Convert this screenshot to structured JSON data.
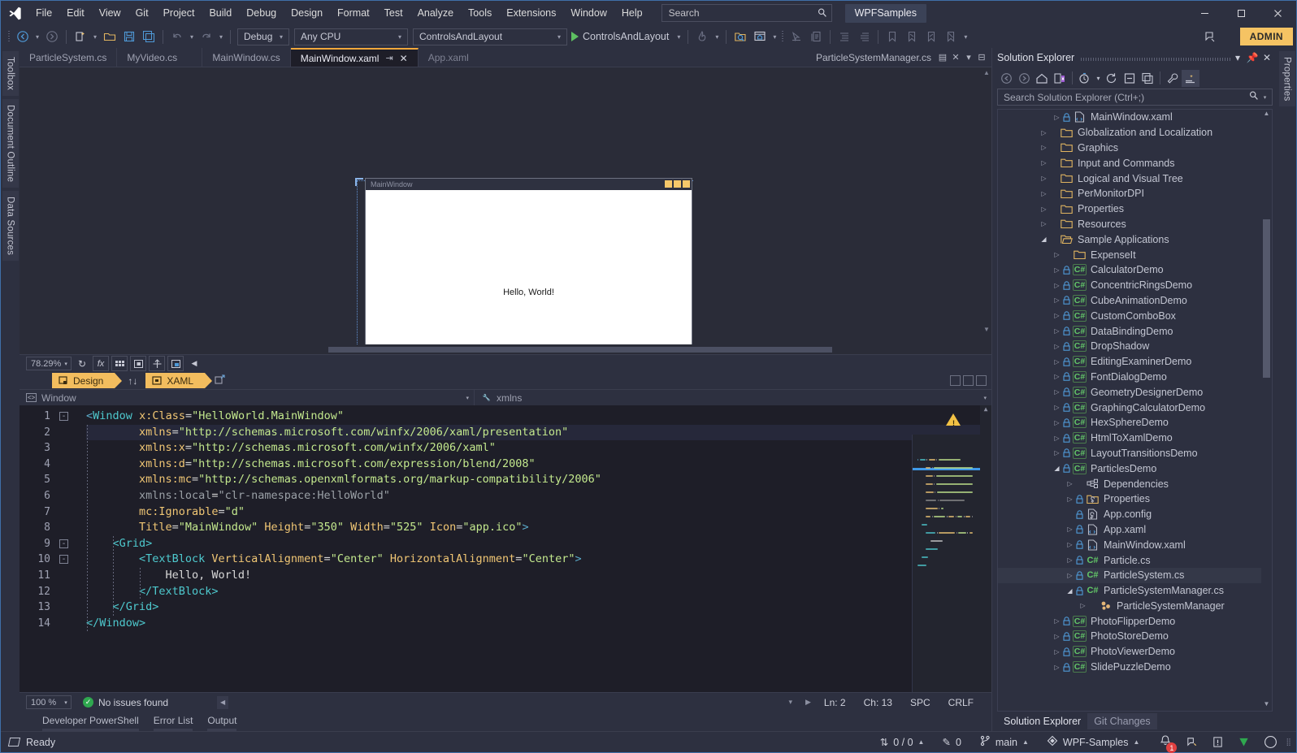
{
  "titlebar": {
    "logo_icon": "visual-studio-logo",
    "menus": [
      "File",
      "Edit",
      "View",
      "Git",
      "Project",
      "Build",
      "Debug",
      "Design",
      "Format",
      "Test",
      "Analyze",
      "Tools",
      "Extensions",
      "Window",
      "Help"
    ],
    "search_placeholder": "Search",
    "search_icon": "magnifier-icon",
    "project_chip": "WPFSamples",
    "window_buttons": {
      "minimize": "─",
      "maximize": "☐",
      "close": "✕"
    }
  },
  "toolbar": {
    "nav_back_icon": "navigate-back-icon",
    "nav_forward_icon": "navigate-forward-icon",
    "new_item_icon": "new-item-icon",
    "open_file_icon": "open-file-icon",
    "save_icon": "save-icon",
    "save_all_icon": "save-all-icon",
    "undo_icon": "undo-icon",
    "redo_icon": "redo-icon",
    "config_value": "Debug",
    "platform_value": "Any CPU",
    "startup_value": "ControlsAndLayout",
    "run_label": "ControlsAndLayout",
    "run_icon": "play-icon",
    "hot_reload_icon": "hot-reload-icon",
    "find_in_files_icon": "find-in-files-icon",
    "solution_explorer_icon": "window-home-icon",
    "pointer_icon": "pointer-icon",
    "comment_icon": "comment-icon",
    "indent_icon": "indent-icon",
    "outdent_icon": "outdent-icon",
    "bookmark_icons": [
      "bookmark-icon",
      "bookmark-next-icon",
      "bookmark-prev-icon",
      "bookmark-clear-icon"
    ],
    "feedback_icon": "feedback-icon",
    "admin_label": "ADMIN"
  },
  "left_rail": [
    "Toolbox",
    "Document Outline",
    "Data Sources"
  ],
  "right_rail": [
    "Properties"
  ],
  "tabs": {
    "items": [
      {
        "label": "ParticleSystem.cs",
        "selected": false
      },
      {
        "label": "MyVideo.cs",
        "selected": false
      },
      {
        "label": "MainWindow.cs",
        "selected": false
      },
      {
        "label": "MainWindow.xaml",
        "selected": true
      },
      {
        "label": "App.xaml",
        "selected": false
      }
    ],
    "pin_icon": "pin-icon",
    "close_icon": "close-icon",
    "right_doc": "ParticleSystemManager.cs",
    "right_close_icon": "close-icon",
    "right_chevron_icon": "chevron-down-icon",
    "right_list_icon": "document-list-icon"
  },
  "designer": {
    "window_title": "MainWindow",
    "content_text": "Hello, World!",
    "caption_buttons": 3
  },
  "designer_toolbar": {
    "zoom_value": "78.29%",
    "refresh_icon": "refresh-icon",
    "effects_icon": "fx-icon",
    "grid_icon": "grid-icon",
    "snaplines_icon": "snaplines-icon",
    "alignment_icon": "alignment-icon",
    "image_icon": "image-icon",
    "collapse_icon": "collapse-left-icon"
  },
  "view_tabs": {
    "design": "Design",
    "design_icon": "design-view-icon",
    "xaml": "XAML",
    "xaml_icon": "xaml-view-icon",
    "swap_icon": "swap-panes-icon",
    "popout_icon": "pop-out-icon"
  },
  "navbar": {
    "scope": "Window",
    "member": "xmlns",
    "scope_icon": "xml-element-icon",
    "member_icon": "wrench-icon",
    "chevron_icon": "chevron-down-icon"
  },
  "code": {
    "lines": [
      {
        "n": 1,
        "fold": "-",
        "segments": [
          {
            "t": "<",
            "c": "ang"
          },
          {
            "t": "Window",
            "c": "tag"
          },
          {
            "t": " ",
            "c": "txt"
          },
          {
            "t": "x:Class",
            "c": "attr"
          },
          {
            "t": "=",
            "c": "eq"
          },
          {
            "t": "\"HelloWorld.MainWindow\"",
            "c": "str"
          }
        ]
      },
      {
        "n": 2,
        "indent": 8,
        "segments": [
          {
            "t": "xmlns",
            "c": "attr"
          },
          {
            "t": "=",
            "c": "eq"
          },
          {
            "t": "\"http://schemas.microsoft.com/winfx/2006/xaml/presentation\"",
            "c": "str"
          }
        ]
      },
      {
        "n": 3,
        "indent": 8,
        "segments": [
          {
            "t": "xmlns:x",
            "c": "attr"
          },
          {
            "t": "=",
            "c": "eq"
          },
          {
            "t": "\"http://schemas.microsoft.com/winfx/2006/xaml\"",
            "c": "str"
          }
        ]
      },
      {
        "n": 4,
        "indent": 8,
        "segments": [
          {
            "t": "xmlns:d",
            "c": "attr"
          },
          {
            "t": "=",
            "c": "eq"
          },
          {
            "t": "\"http://schemas.microsoft.com/expression/blend/2008\"",
            "c": "str"
          }
        ]
      },
      {
        "n": 5,
        "indent": 8,
        "segments": [
          {
            "t": "xmlns:mc",
            "c": "attr"
          },
          {
            "t": "=",
            "c": "eq"
          },
          {
            "t": "\"http://schemas.openxmlformats.org/markup-compatibility/2006\"",
            "c": "str"
          }
        ]
      },
      {
        "n": 6,
        "indent": 8,
        "segments": [
          {
            "t": "xmlns:local",
            "c": "gray"
          },
          {
            "t": "=",
            "c": "eq"
          },
          {
            "t": "\"clr-namespace:HelloWorld\"",
            "c": "gray"
          }
        ]
      },
      {
        "n": 7,
        "indent": 8,
        "segments": [
          {
            "t": "mc:Ignorable",
            "c": "attr"
          },
          {
            "t": "=",
            "c": "eq"
          },
          {
            "t": "\"d\"",
            "c": "str"
          }
        ]
      },
      {
        "n": 8,
        "indent": 8,
        "segments": [
          {
            "t": "Title",
            "c": "attr"
          },
          {
            "t": "=",
            "c": "eq"
          },
          {
            "t": "\"MainWindow\"",
            "c": "str"
          },
          {
            "t": " ",
            "c": "txt"
          },
          {
            "t": "Height",
            "c": "attr"
          },
          {
            "t": "=",
            "c": "eq"
          },
          {
            "t": "\"350\"",
            "c": "str"
          },
          {
            "t": " ",
            "c": "txt"
          },
          {
            "t": "Width",
            "c": "attr"
          },
          {
            "t": "=",
            "c": "eq"
          },
          {
            "t": "\"525\"",
            "c": "str"
          },
          {
            "t": " ",
            "c": "txt"
          },
          {
            "t": "Icon",
            "c": "attr"
          },
          {
            "t": "=",
            "c": "eq"
          },
          {
            "t": "\"app.ico\"",
            "c": "str"
          },
          {
            "t": ">",
            "c": "ang"
          }
        ]
      },
      {
        "n": 9,
        "fold": "-",
        "indent": 4,
        "segments": [
          {
            "t": "<Grid>",
            "c": "tag"
          }
        ]
      },
      {
        "n": 10,
        "fold": "-",
        "indent": 8,
        "segments": [
          {
            "t": "<TextBlock",
            "c": "tag"
          },
          {
            "t": " ",
            "c": "txt"
          },
          {
            "t": "VerticalAlignment",
            "c": "attr"
          },
          {
            "t": "=",
            "c": "eq"
          },
          {
            "t": "\"Center\"",
            "c": "str"
          },
          {
            "t": " ",
            "c": "txt"
          },
          {
            "t": "HorizontalAlignment",
            "c": "attr"
          },
          {
            "t": "=",
            "c": "eq"
          },
          {
            "t": "\"Center\"",
            "c": "str"
          },
          {
            "t": ">",
            "c": "ang"
          }
        ]
      },
      {
        "n": 11,
        "indent": 12,
        "segments": [
          {
            "t": "Hello, World!",
            "c": "txt"
          }
        ]
      },
      {
        "n": 12,
        "indent": 8,
        "segments": [
          {
            "t": "</TextBlock>",
            "c": "tag"
          }
        ]
      },
      {
        "n": 13,
        "indent": 4,
        "segments": [
          {
            "t": "</Grid>",
            "c": "tag"
          }
        ]
      },
      {
        "n": 14,
        "segments": [
          {
            "t": "</Window>",
            "c": "tag"
          }
        ]
      }
    ],
    "current_line": 2,
    "minimap_warning_icon": "warning-triangle-icon"
  },
  "editor_status": {
    "zoom": "100 %",
    "issues_icon": "check-circle-icon",
    "issues_text": "No issues found",
    "line": "Ln: 2",
    "col": "Ch: 13",
    "spaces": "SPC",
    "eol": "CRLF"
  },
  "bottom_tabs": [
    "Developer PowerShell",
    "Error List",
    "Output"
  ],
  "solution_explorer": {
    "title": "Solution Explorer",
    "chevron_icon": "chevron-down-icon",
    "pin_icon": "pin-icon",
    "close_icon": "close-icon",
    "toolbar_icons": [
      "back-icon",
      "forward-icon",
      "home-icon",
      "sync-with-document-icon",
      "pending-changes-icon",
      "refresh-icon",
      "collapse-all-icon",
      "show-all-files-icon",
      "properties-wrench-icon",
      "preview-selected-icon"
    ],
    "search_placeholder": "Search Solution Explorer (Ctrl+;)",
    "search_icon": "magnifier-icon",
    "search_chevron_icon": "chevron-down-icon",
    "tree": [
      {
        "depth": 4,
        "label": "MainWindow.xaml",
        "expander": "collapsed",
        "lock": true,
        "icon": "xaml-file-icon"
      },
      {
        "depth": 3,
        "label": "Globalization and Localization",
        "expander": "collapsed",
        "icon": "folder-icon"
      },
      {
        "depth": 3,
        "label": "Graphics",
        "expander": "collapsed",
        "icon": "folder-icon"
      },
      {
        "depth": 3,
        "label": "Input and Commands",
        "expander": "collapsed",
        "icon": "folder-icon"
      },
      {
        "depth": 3,
        "label": "Logical and Visual Tree",
        "expander": "collapsed",
        "icon": "folder-icon"
      },
      {
        "depth": 3,
        "label": "PerMonitorDPI",
        "expander": "collapsed",
        "icon": "folder-icon"
      },
      {
        "depth": 3,
        "label": "Properties",
        "expander": "collapsed",
        "icon": "folder-icon"
      },
      {
        "depth": 3,
        "label": "Resources",
        "expander": "collapsed",
        "icon": "folder-icon"
      },
      {
        "depth": 3,
        "label": "Sample Applications",
        "expander": "expanded",
        "icon": "folder-open-icon"
      },
      {
        "depth": 4,
        "label": "ExpenseIt",
        "expander": "collapsed",
        "icon": "folder-icon"
      },
      {
        "depth": 4,
        "label": "CalculatorDemo",
        "expander": "collapsed",
        "lock": true,
        "icon": "csharp-project-icon"
      },
      {
        "depth": 4,
        "label": "ConcentricRingsDemo",
        "expander": "collapsed",
        "lock": true,
        "icon": "csharp-project-icon"
      },
      {
        "depth": 4,
        "label": "CubeAnimationDemo",
        "expander": "collapsed",
        "lock": true,
        "icon": "csharp-project-icon"
      },
      {
        "depth": 4,
        "label": "CustomComboBox",
        "expander": "collapsed",
        "lock": true,
        "icon": "csharp-project-icon"
      },
      {
        "depth": 4,
        "label": "DataBindingDemo",
        "expander": "collapsed",
        "lock": true,
        "icon": "csharp-project-icon"
      },
      {
        "depth": 4,
        "label": "DropShadow",
        "expander": "collapsed",
        "lock": true,
        "icon": "csharp-project-icon"
      },
      {
        "depth": 4,
        "label": "EditingExaminerDemo",
        "expander": "collapsed",
        "lock": true,
        "icon": "csharp-project-icon"
      },
      {
        "depth": 4,
        "label": "FontDialogDemo",
        "expander": "collapsed",
        "lock": true,
        "icon": "csharp-project-icon"
      },
      {
        "depth": 4,
        "label": "GeometryDesignerDemo",
        "expander": "collapsed",
        "lock": true,
        "icon": "csharp-project-icon"
      },
      {
        "depth": 4,
        "label": "GraphingCalculatorDemo",
        "expander": "collapsed",
        "lock": true,
        "icon": "csharp-project-icon"
      },
      {
        "depth": 4,
        "label": "HexSphereDemo",
        "expander": "collapsed",
        "lock": true,
        "icon": "csharp-project-icon"
      },
      {
        "depth": 4,
        "label": "HtmlToXamlDemo",
        "expander": "collapsed",
        "lock": true,
        "icon": "csharp-project-icon"
      },
      {
        "depth": 4,
        "label": "LayoutTransitionsDemo",
        "expander": "collapsed",
        "lock": true,
        "icon": "csharp-project-icon"
      },
      {
        "depth": 4,
        "label": "ParticlesDemo",
        "expander": "expanded",
        "lock": true,
        "icon": "csharp-project-icon"
      },
      {
        "depth": 5,
        "label": "Dependencies",
        "expander": "collapsed",
        "icon": "dependencies-icon"
      },
      {
        "depth": 5,
        "label": "Properties",
        "expander": "collapsed",
        "lock": true,
        "icon": "properties-folder-icon"
      },
      {
        "depth": 5,
        "label": "App.config",
        "expander": "none",
        "lock": true,
        "icon": "config-file-icon"
      },
      {
        "depth": 5,
        "label": "App.xaml",
        "expander": "collapsed",
        "lock": true,
        "icon": "xaml-file-icon"
      },
      {
        "depth": 5,
        "label": "MainWindow.xaml",
        "expander": "collapsed",
        "lock": true,
        "icon": "xaml-file-icon"
      },
      {
        "depth": 5,
        "label": "Particle.cs",
        "expander": "collapsed",
        "lock": true,
        "icon": "csharp-file-icon"
      },
      {
        "depth": 5,
        "label": "ParticleSystem.cs",
        "expander": "collapsed",
        "lock": true,
        "icon": "csharp-file-icon",
        "selected": true
      },
      {
        "depth": 5,
        "label": "ParticleSystemManager.cs",
        "expander": "expanded",
        "lock": true,
        "icon": "csharp-file-icon"
      },
      {
        "depth": 6,
        "label": "ParticleSystemManager",
        "expander": "collapsed",
        "icon": "class-icon"
      },
      {
        "depth": 4,
        "label": "PhotoFlipperDemo",
        "expander": "collapsed",
        "lock": true,
        "icon": "csharp-project-icon"
      },
      {
        "depth": 4,
        "label": "PhotoStoreDemo",
        "expander": "collapsed",
        "lock": true,
        "icon": "csharp-project-icon"
      },
      {
        "depth": 4,
        "label": "PhotoViewerDemo",
        "expander": "collapsed",
        "lock": true,
        "icon": "csharp-project-icon"
      },
      {
        "depth": 4,
        "label": "SlidePuzzleDemo",
        "expander": "collapsed",
        "lock": true,
        "icon": "csharp-project-icon"
      }
    ],
    "footer_tabs": [
      {
        "label": "Solution Explorer",
        "active": true
      },
      {
        "label": "Git Changes",
        "active": false
      }
    ]
  },
  "statusbar": {
    "ready": "Ready",
    "ready_icon": "status-ready-icon",
    "source_control_icon": "updown-arrows-icon",
    "source_control_value": "0 / 0",
    "edits_icon": "pencil-icon",
    "edits_value": "0",
    "branch_icon": "branch-icon",
    "branch_value": "main",
    "repo_icon": "repository-icon",
    "repo_value": "WPF-Samples",
    "bell_icon": "bell-icon",
    "bell_badge": "1",
    "feedback_icon": "feedback-smiley-icon",
    "notify_icon": "notification-icon",
    "check_icon": "green-check-icon",
    "circle_icon": "circle-icon"
  }
}
